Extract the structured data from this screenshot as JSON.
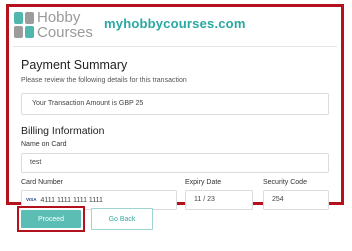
{
  "header": {
    "logo_line1": "Hobby",
    "logo_line2": "Courses",
    "site_name": "myhobbycourses.com"
  },
  "payment": {
    "title": "Payment Summary",
    "subtitle": "Please review the following details for this transaction",
    "amount_text": "Your Transaction Amount is GBP 25"
  },
  "billing": {
    "title": "Billing Information",
    "name_label": "Name on Card",
    "name_value": "test",
    "card_label": "Card Number",
    "card_brand": "VISA",
    "card_value": "4111 1111 1111 1111",
    "expiry_label": "Expiry Date",
    "expiry_value": "11 / 23",
    "security_label": "Security Code",
    "security_value": "254"
  },
  "actions": {
    "proceed_label": "Proceed",
    "back_label": "Go Back"
  },
  "colors": {
    "highlight": "#b3121c",
    "brand_teal": "#2aa8a0",
    "button_teal": "#5cbdb4"
  }
}
